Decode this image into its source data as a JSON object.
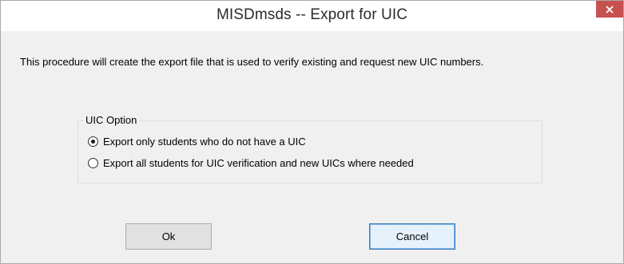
{
  "window": {
    "title": "MISDmsds  -- Export for UIC",
    "close_icon": "close-icon",
    "close_color": "#c75050"
  },
  "description": "This procedure will create the export file that is used to verify existing and request new UIC numbers.",
  "uic_option": {
    "legend": "UIC Option",
    "options": [
      {
        "label": "Export only students who do not have a UIC",
        "selected": true
      },
      {
        "label": "Export all students for UIC verification and new UICs where needed",
        "selected": false
      }
    ]
  },
  "buttons": {
    "ok_label": "Ok",
    "cancel_label": "Cancel"
  }
}
